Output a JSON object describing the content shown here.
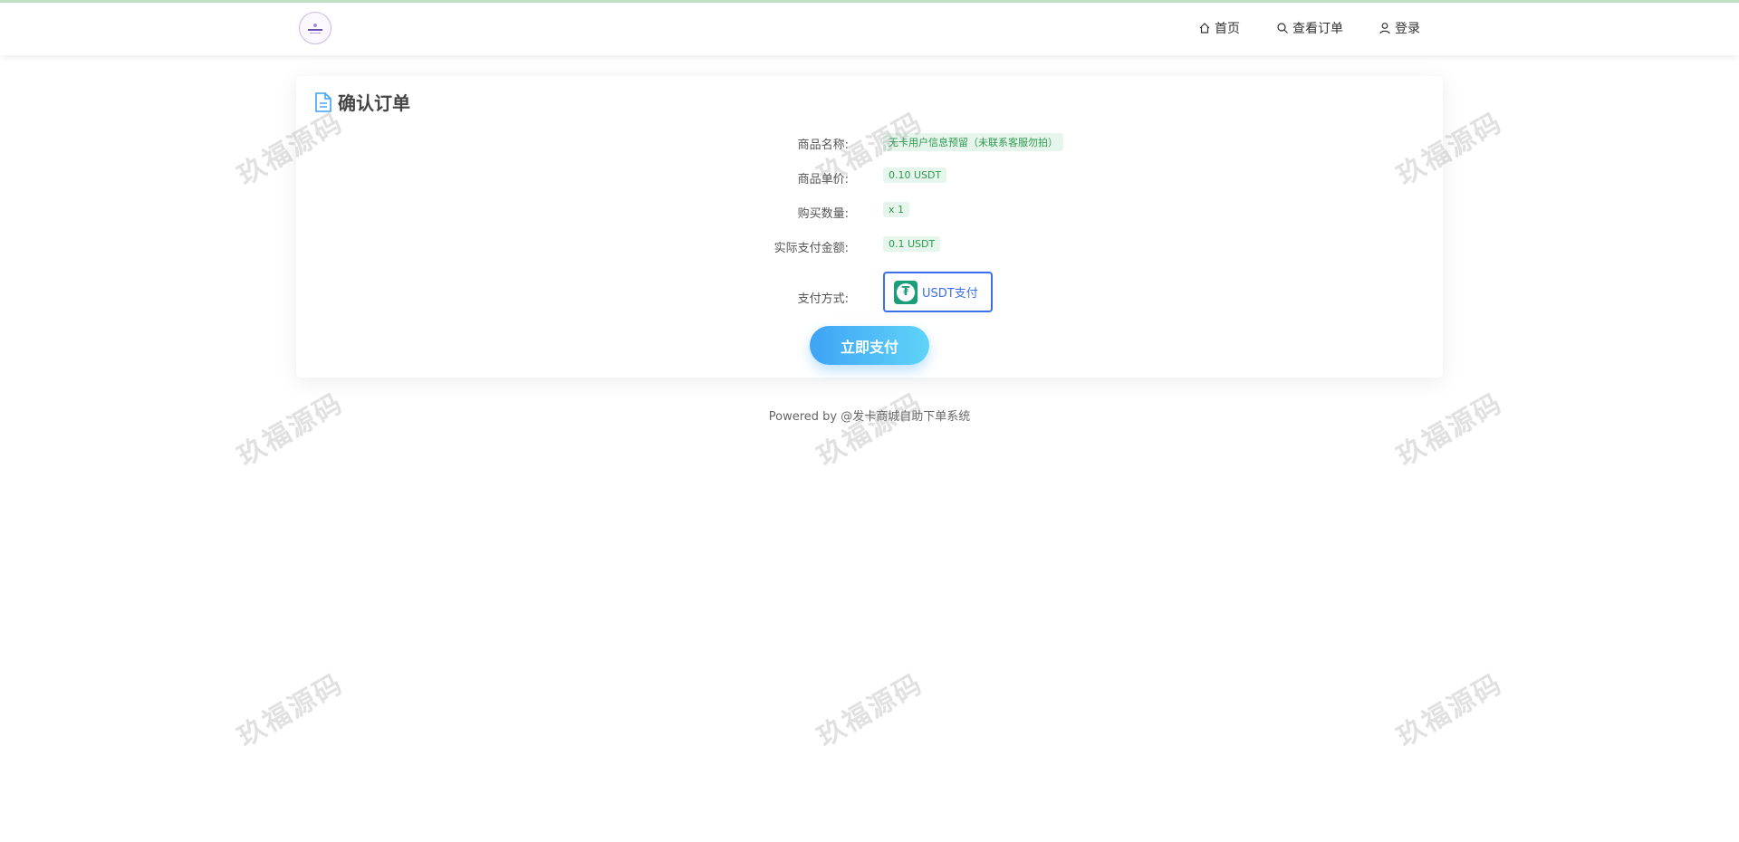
{
  "nav": {
    "home": "首页",
    "orders": "查看订单",
    "login": "登录"
  },
  "order": {
    "title": "确认订单",
    "product_name_label": "商品名称:",
    "product_name": "无卡用户信息预留（未联系客服勿拍）",
    "unit_price_label": "商品单价:",
    "unit_price": "0.10 USDT",
    "quantity_label": "购买数量:",
    "quantity": "x 1",
    "total_label": "实际支付金额:",
    "total": "0.1 USDT",
    "pay_method_label": "支付方式:",
    "pay_method": "USDT支付",
    "pay_button": "立即支付"
  },
  "footer": {
    "text": "Powered by @发卡商城自助下单系统"
  },
  "watermark": "玖福源码",
  "colors": {
    "accent": "#3c6ef0",
    "pill_bg": "#e6f6ec",
    "pill_text": "#2d9a4e",
    "tether": "#1a9e7a"
  }
}
